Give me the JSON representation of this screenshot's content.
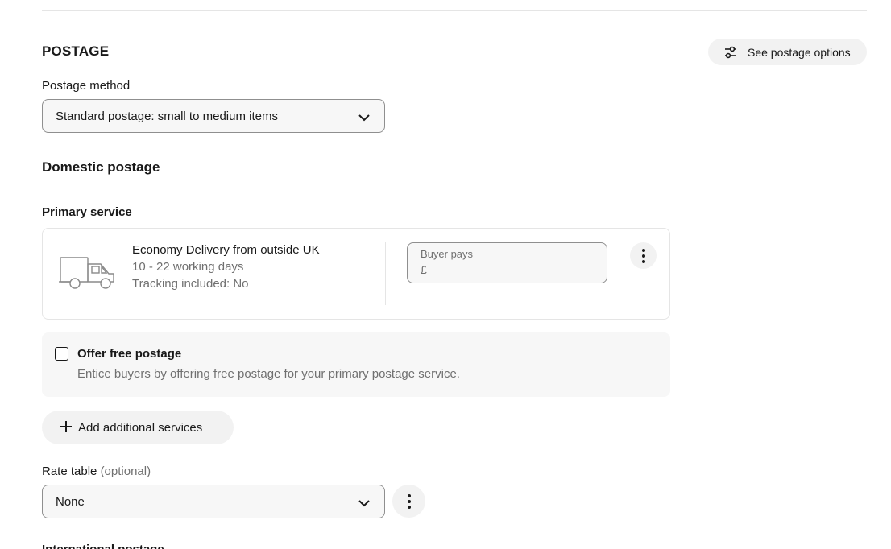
{
  "section": {
    "title": "POSTAGE"
  },
  "options_button": {
    "label": "See postage options",
    "icon": "sliders-icon"
  },
  "postage_method": {
    "label": "Postage method",
    "selected": "Standard postage: small to medium items"
  },
  "domestic": {
    "heading": "Domestic postage",
    "primary_label": "Primary service",
    "service": {
      "name": "Economy Delivery from outside UK",
      "duration": "10 - 22 working days",
      "tracking": "Tracking included: No",
      "icon": "delivery-van-icon"
    },
    "price": {
      "label": "Buyer pays",
      "currency": "£",
      "value": ""
    }
  },
  "free_postage": {
    "title": "Offer free postage",
    "description": "Entice buyers by offering free postage for your primary postage service.",
    "checked": false
  },
  "add_services": {
    "label": "Add additional services"
  },
  "rate_table": {
    "label": "Rate table",
    "optional": "(optional)",
    "selected": "None"
  },
  "cut_off_heading": "International postage",
  "colors": {
    "text": "#191919",
    "muted": "#707070",
    "button_bg": "#f2f2f2",
    "border": "#8f8f8f"
  }
}
